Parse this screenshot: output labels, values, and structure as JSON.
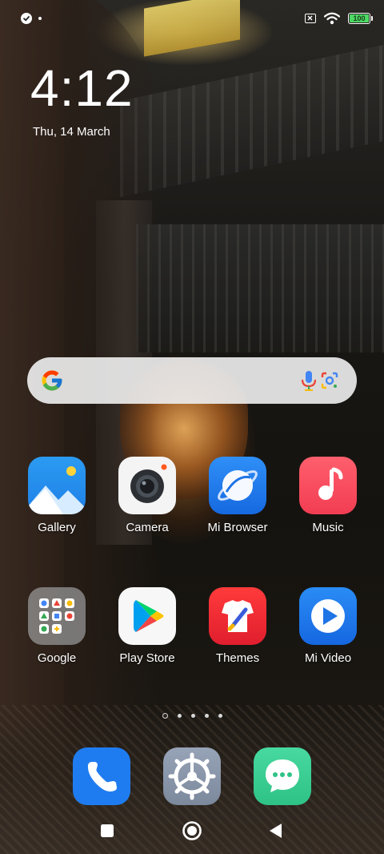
{
  "status_bar": {
    "battery_level": "100",
    "battery_color": "#4cd964",
    "icons": [
      "check-circle-icon",
      "notification-dot-icon",
      "no-sim-icon",
      "wifi-icon",
      "battery-icon"
    ]
  },
  "clock": {
    "time": "4:12",
    "date": "Thu, 14 March"
  },
  "search_widget": {
    "icons": [
      "google-g-icon",
      "microphone-icon",
      "google-lens-icon"
    ]
  },
  "apps": {
    "row1": [
      {
        "label": "Gallery",
        "icon": "gallery-icon"
      },
      {
        "label": "Camera",
        "icon": "camera-icon"
      },
      {
        "label": "Mi Browser",
        "icon": "browser-icon"
      },
      {
        "label": "Music",
        "icon": "music-icon"
      }
    ],
    "row2": [
      {
        "label": "Google",
        "icon": "google-folder-icon"
      },
      {
        "label": "Play Store",
        "icon": "play-store-icon"
      },
      {
        "label": "Themes",
        "icon": "themes-icon"
      },
      {
        "label": "Mi Video",
        "icon": "video-icon"
      }
    ]
  },
  "page_indicator": {
    "pages": 5,
    "current": 0
  },
  "dock": [
    {
      "icon": "phone-icon",
      "color": "#1f7cf0"
    },
    {
      "icon": "settings-icon",
      "color": "#8a96a8"
    },
    {
      "icon": "messages-icon",
      "color": "#3ecf94"
    }
  ],
  "nav_bar": {
    "buttons": [
      "recents-button",
      "home-button",
      "back-button"
    ]
  }
}
